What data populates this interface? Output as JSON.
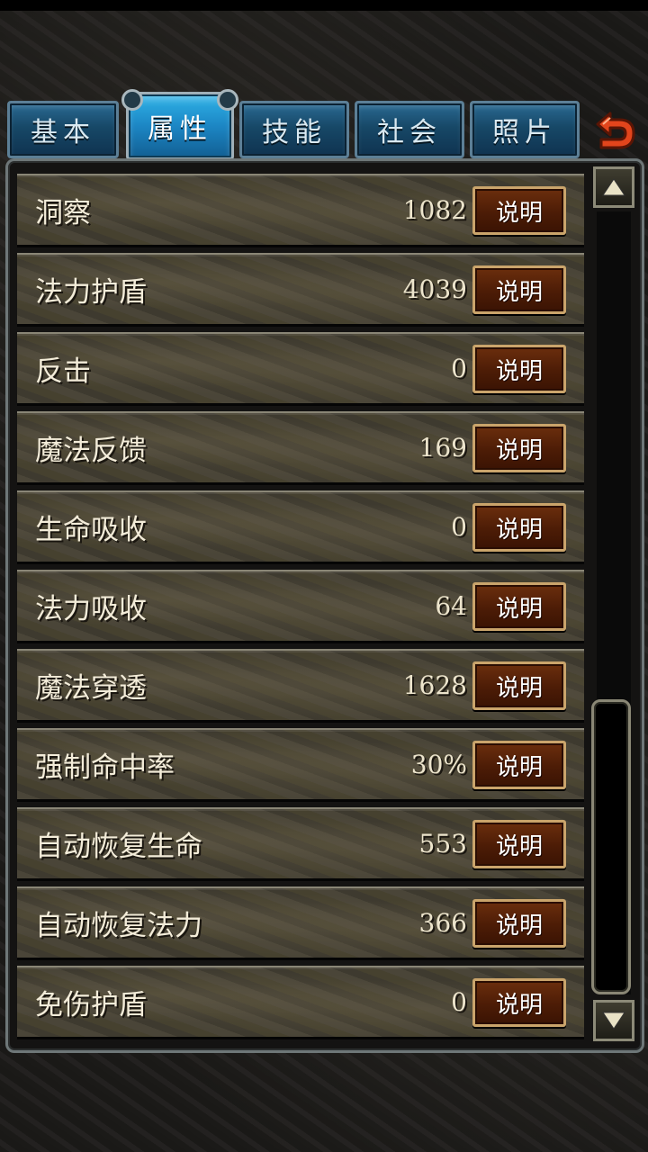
{
  "tabs": [
    {
      "label": "基本"
    },
    {
      "label": "属性"
    },
    {
      "label": "技能"
    },
    {
      "label": "社会"
    },
    {
      "label": "照片"
    }
  ],
  "active_tab": "属性",
  "button_label": "说明",
  "attributes": [
    {
      "label": "洞察",
      "value": "1082"
    },
    {
      "label": "法力护盾",
      "value": "4039"
    },
    {
      "label": "反击",
      "value": "0"
    },
    {
      "label": "魔法反馈",
      "value": "169"
    },
    {
      "label": "生命吸收",
      "value": "0"
    },
    {
      "label": "法力吸收",
      "value": "64"
    },
    {
      "label": "魔法穿透",
      "value": "1628"
    },
    {
      "label": "强制命中率",
      "value": "30%"
    },
    {
      "label": "自动恢复生命",
      "value": "553"
    },
    {
      "label": "自动恢复法力",
      "value": "366"
    },
    {
      "label": "免伤护盾",
      "value": "0"
    }
  ],
  "icons": {
    "back": "back-arrow-icon",
    "scroll_up": "triangle-up-icon",
    "scroll_down": "triangle-down-icon"
  },
  "colors": {
    "tab_blue": "#174867",
    "tab_active": "#1c86c4",
    "button_brown": "#4c1c06",
    "back_arrow": "#e2451c"
  },
  "scroll": {
    "position_fraction": 0.62,
    "visible_fraction": 0.38
  }
}
